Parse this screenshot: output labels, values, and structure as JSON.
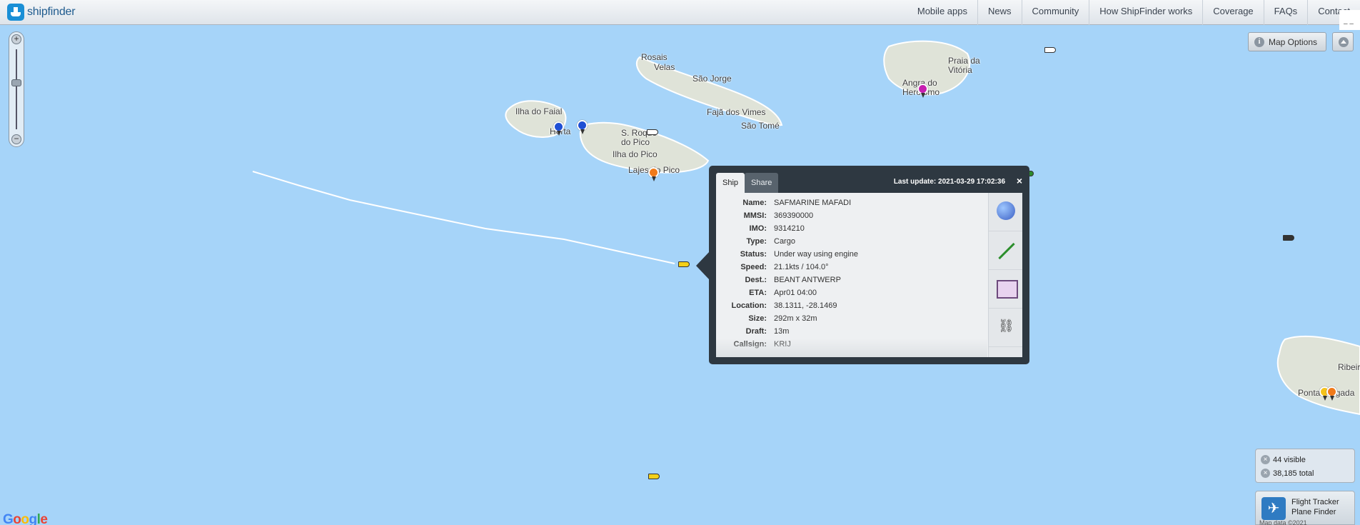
{
  "brand": {
    "name": "shipfinder"
  },
  "nav": [
    "Mobile apps",
    "News",
    "Community",
    "How ShipFinder works",
    "Coverage",
    "FAQs",
    "Contact"
  ],
  "map_options": {
    "label": "Map Options"
  },
  "map_labels": [
    "Ilha do Faial",
    "Horta",
    "S. Roque do Pico",
    "Ilha do Pico",
    "Lajes do Pico",
    "Rosais",
    "Velas",
    "São Jorge",
    "Fajã dos Vimes",
    "São Tomé",
    "Praia da Vitória",
    "Angra do Heroísmo",
    "Ribeira",
    "Ponta Delgada"
  ],
  "popup": {
    "tabs": [
      "Ship",
      "Share"
    ],
    "last_update": "Last update: 2021-03-29 17:02:36",
    "close": "×",
    "fields": [
      {
        "key": "Name:",
        "value": "SAFMARINE MAFADI"
      },
      {
        "key": "MMSI:",
        "value": "369390000"
      },
      {
        "key": "IMO:",
        "value": "9314210"
      },
      {
        "key": "Type:",
        "value": "Cargo"
      },
      {
        "key": "Status:",
        "value": "Under way using engine"
      },
      {
        "key": "Speed:",
        "value": "21.1kts / 104.0°"
      },
      {
        "key": "Dest.:",
        "value": "BEANT ANTWERP"
      },
      {
        "key": "ETA:",
        "value": "Apr01 04:00"
      },
      {
        "key": "Location:",
        "value": "38.1311, -28.1469"
      },
      {
        "key": "Size:",
        "value": "292m x 32m"
      },
      {
        "key": "Draft:",
        "value": "13m"
      },
      {
        "key": "Callsign:",
        "value": "KRIJ"
      }
    ],
    "tools": [
      "globe-icon",
      "track-icon",
      "photo-icon",
      "link-icon"
    ]
  },
  "counts": {
    "visible": "44 visible",
    "total": "38,185 total"
  },
  "flight_tracker": {
    "line1": "Flight Tracker",
    "line2": "Plane Finder"
  },
  "map_data": "Map data ©2021",
  "google": [
    "G",
    "o",
    "o",
    "g",
    "l",
    "e"
  ],
  "colors": {
    "water": "#a6d4f9",
    "land": "#dfe3d8",
    "popup": "#2e3841",
    "track": "#ffffff"
  }
}
